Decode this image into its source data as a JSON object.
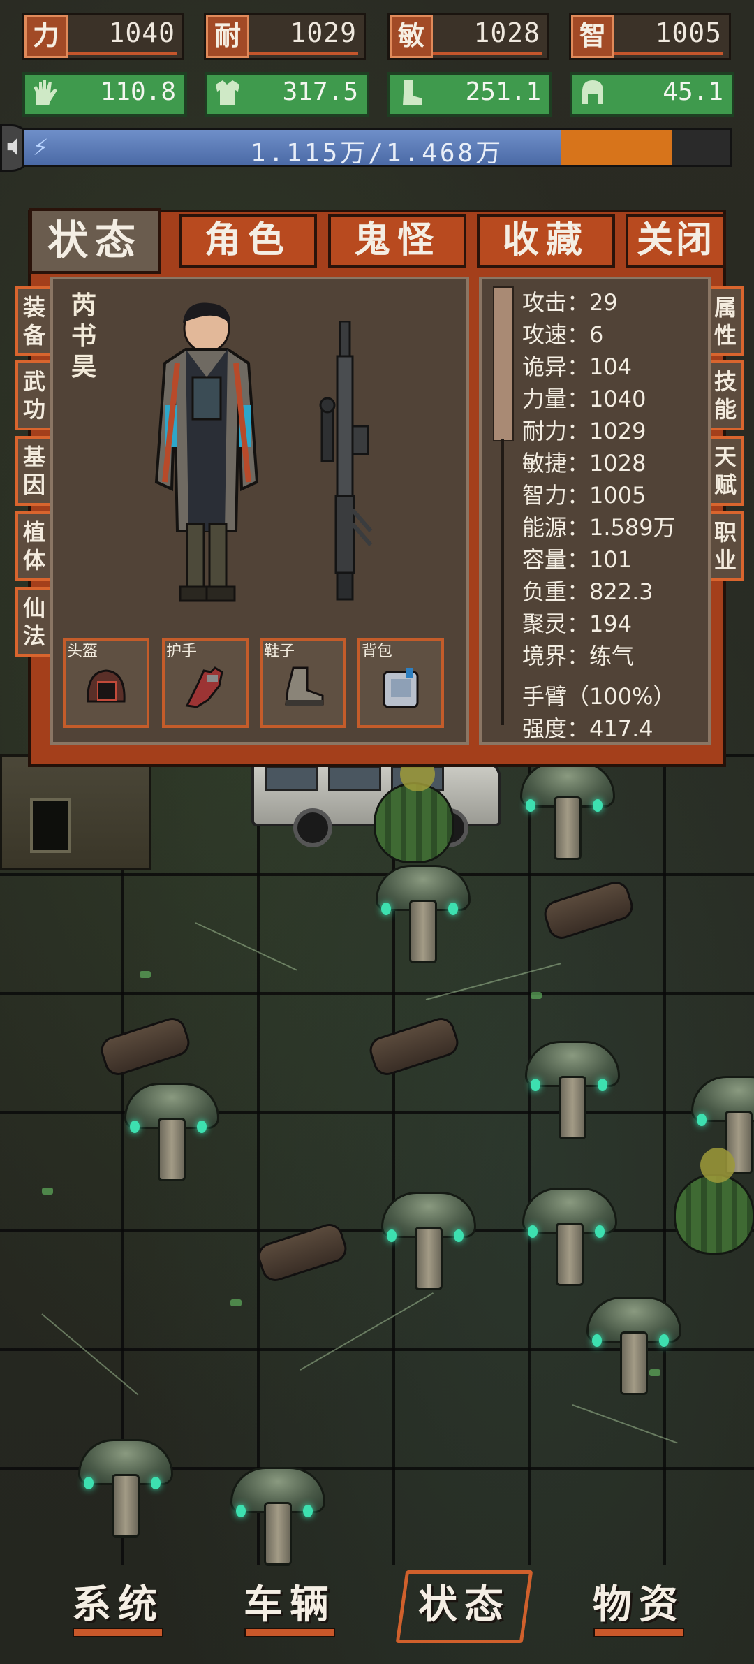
{
  "attributes": [
    {
      "tag": "力",
      "value": "1040"
    },
    {
      "tag": "耐",
      "value": "1029"
    },
    {
      "tag": "敏",
      "value": "1028"
    },
    {
      "tag": "智",
      "value": "1005"
    }
  ],
  "gear_stats": [
    {
      "icon": "glove-icon",
      "value": "110.8"
    },
    {
      "icon": "armor-icon",
      "value": "317.5"
    },
    {
      "icon": "boot-icon",
      "value": "251.1"
    },
    {
      "icon": "helmet-icon",
      "value": "45.1"
    }
  ],
  "energy": {
    "text": "1.115万/1.468万",
    "ratio": 0.76,
    "icon": "lightning-icon"
  },
  "panel": {
    "tabs": [
      "状态",
      "角色",
      "鬼怪",
      "收藏",
      "关闭"
    ],
    "left_tabs": [
      "装备",
      "武功",
      "基因",
      "植体",
      "仙法"
    ],
    "right_tabs": [
      "属性",
      "技能",
      "天赋",
      "职业"
    ],
    "character_name": "芮书昊",
    "slots": [
      {
        "label": "头盔",
        "icon": "helmet-icon"
      },
      {
        "label": "护手",
        "icon": "glove-icon"
      },
      {
        "label": "鞋子",
        "icon": "boot-icon"
      },
      {
        "label": "背包",
        "icon": "backpack-icon"
      }
    ],
    "stats": [
      "攻击：29",
      "攻速：6",
      "诡异：104",
      "力量：1040",
      "耐力：1029",
      "敏捷：1028",
      "智力：1005",
      "能源：1.589万",
      "容量：101",
      "负重：822.3",
      "聚灵：194",
      "境界：练气",
      "手臂（100%）",
      "强度：417.4"
    ]
  },
  "bottom_nav": [
    "系统",
    "车辆",
    "状态",
    "物资"
  ],
  "colors": {
    "accent": "#b84a1f",
    "panel": "#514337",
    "gear": "#3f9a4d",
    "energy": "#4b6aa6",
    "glow": "#3de0b0"
  }
}
